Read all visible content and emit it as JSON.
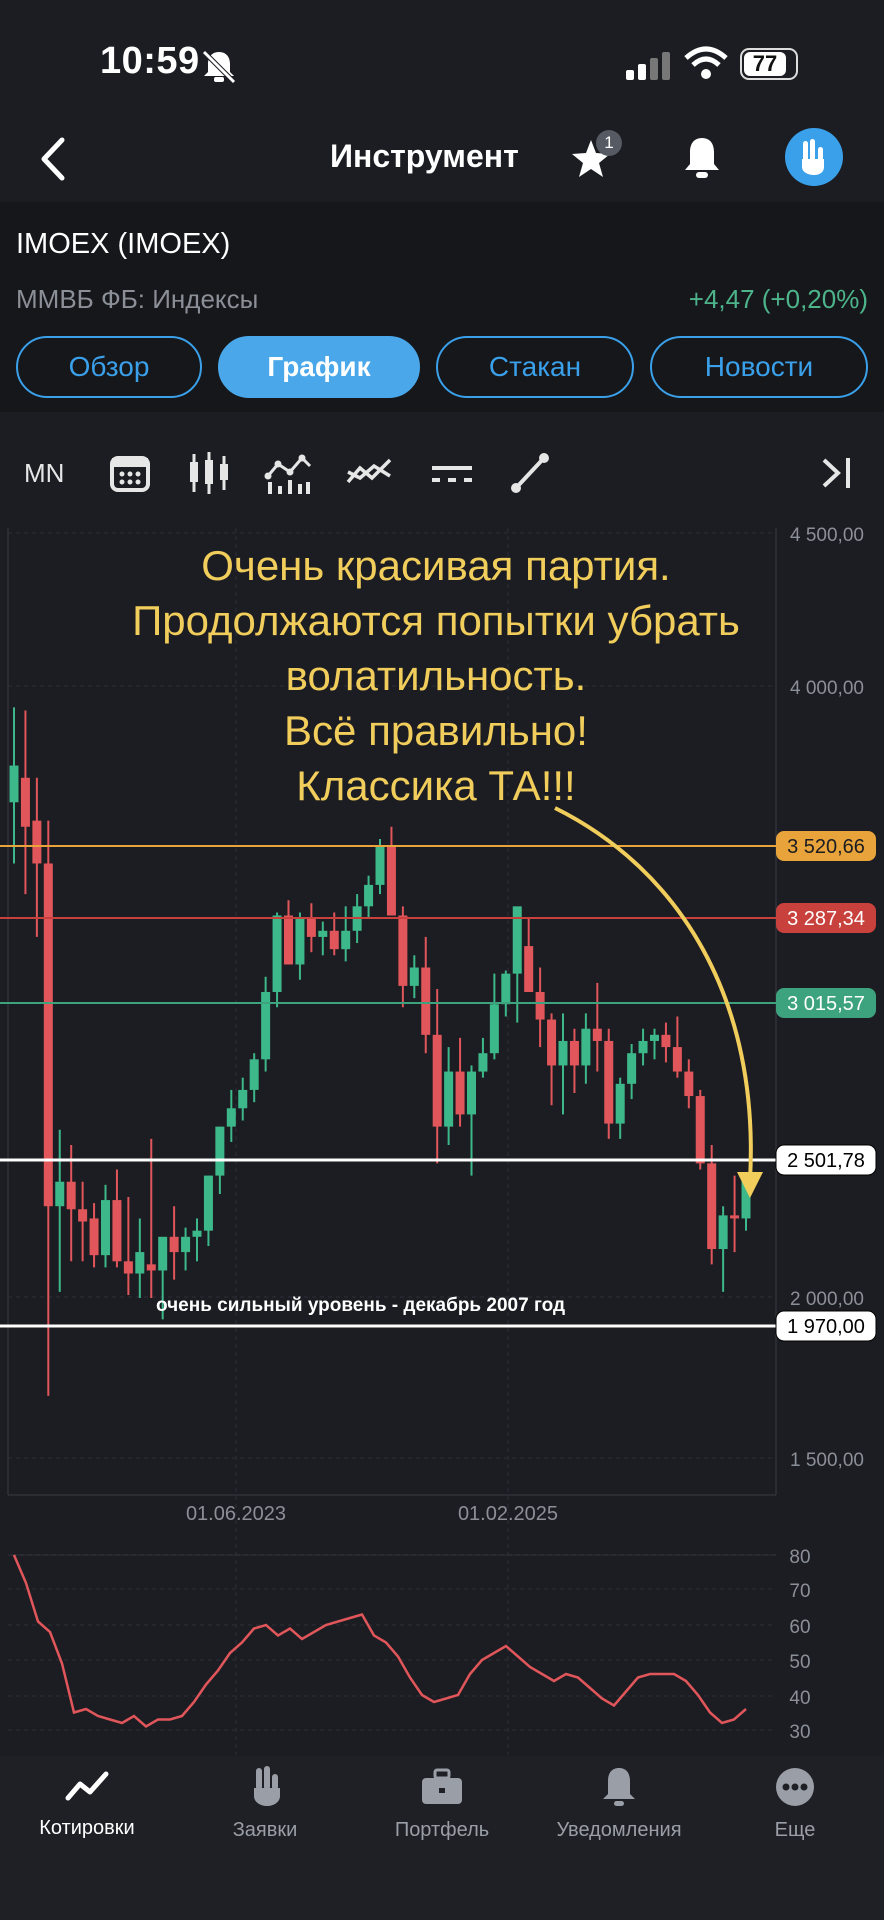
{
  "status": {
    "time": "10:59",
    "battery": "77"
  },
  "header": {
    "title": "Инструмент",
    "favorites_count": "1"
  },
  "instrument": {
    "ticker": "IMOEX (IMOEX)",
    "exchange": "ММВБ ФБ: Индексы",
    "change": "+4,47 (+0,20%)"
  },
  "tabs": [
    {
      "label": "Обзор"
    },
    {
      "label": "График"
    },
    {
      "label": "Стакан"
    },
    {
      "label": "Новости"
    }
  ],
  "toolbar": {
    "interval": "MN"
  },
  "chart_data": {
    "type": "candlestick",
    "y_ticks": [
      "4 500,00",
      "4 000,00",
      "2 000,00",
      "1 500,00"
    ],
    "x_ticks": [
      "01.06.2023",
      "01.02.2025"
    ],
    "levels": [
      {
        "label": "3 520,66",
        "color": "#e8a33a"
      },
      {
        "label": "3 287,34",
        "color": "#c8413c"
      },
      {
        "label": "3 015,57",
        "color": "#3da37e"
      },
      {
        "label": "2 501,78",
        "color": "#ffffff"
      },
      {
        "label": "1 970,00",
        "color": "#ffffff"
      }
    ],
    "annotation_lines": [
      "Очень красивая партия.",
      "Продолжаются попытки убрать",
      "волатильность.",
      "Всё правильно!",
      "Классика ТА!!!"
    ],
    "level_note": "очень сильный уровень - декабрь 2007 год",
    "oscillator_ticks": [
      "80",
      "70",
      "60",
      "50",
      "40",
      "30"
    ]
  },
  "bottom_nav": [
    {
      "label": "Котировки"
    },
    {
      "label": "Заявки"
    },
    {
      "label": "Портфель"
    },
    {
      "label": "Уведомления"
    },
    {
      "label": "Еще"
    }
  ]
}
